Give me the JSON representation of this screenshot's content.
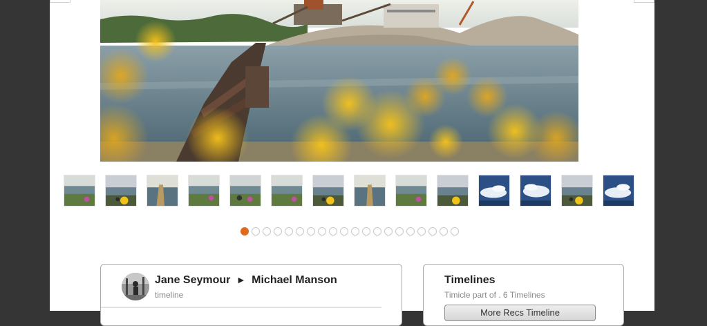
{
  "post": {
    "author": "Jane Seymour",
    "arrow": "►",
    "recipient": "Michael Manson",
    "subtitle": "timeline"
  },
  "timelines": {
    "title": "Timelines",
    "subtitle": "Timicle part of . 6 Timelines",
    "button_label": "More Recs Timeline"
  },
  "gallery": {
    "thumbnail_count": 14,
    "thumbnail_themes": [
      "lake",
      "lake-flower",
      "lake",
      "lake-flower",
      "lake-flower",
      "lake-flower",
      "lake-flower",
      "lake",
      "lake-flower",
      "lake-flower",
      "sky-clouds",
      "sky-clouds",
      "lake-flower",
      "sky-clouds"
    ],
    "page_count": 20,
    "active_page": 1,
    "accent_color": "#e06a1c"
  },
  "colors": {
    "background": "#353535",
    "page": "#ffffff",
    "card_border": "#a9a9a9"
  }
}
